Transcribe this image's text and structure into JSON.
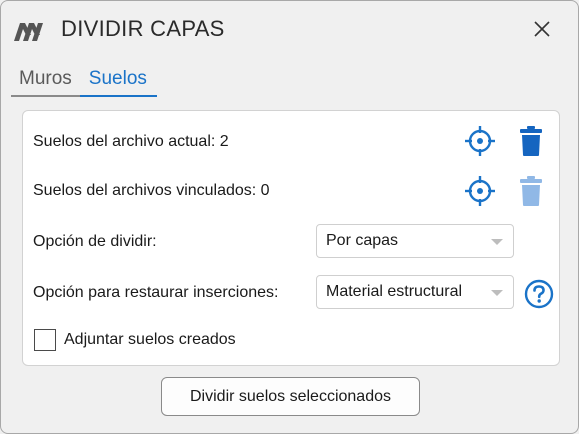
{
  "window": {
    "title": "DIVIDIR CAPAS",
    "close_icon": "close-icon",
    "logo_icon": "app-logo-icon"
  },
  "tabs": [
    {
      "label": "Muros",
      "active": false
    },
    {
      "label": "Suelos",
      "active": true
    }
  ],
  "panel": {
    "current_file_label": "Suelos del archivo actual: 2",
    "linked_files_label": "Suelos del archivos vinculados: 0",
    "split_option_label": "Opción de dividir:",
    "split_option_value": "Por capas",
    "restore_option_label": "Opción para restaurar inserciones:",
    "restore_option_value": "Material estructural",
    "attach_checkbox_label": "Adjuntar suelos creados",
    "attach_checked": false
  },
  "actions": {
    "split_button_label": "Dividir suelos seleccionados"
  },
  "colors": {
    "accent": "#1a73c8",
    "delete_enabled": "#1565c0",
    "delete_disabled": "#90b8e6",
    "logo": "#555555"
  }
}
